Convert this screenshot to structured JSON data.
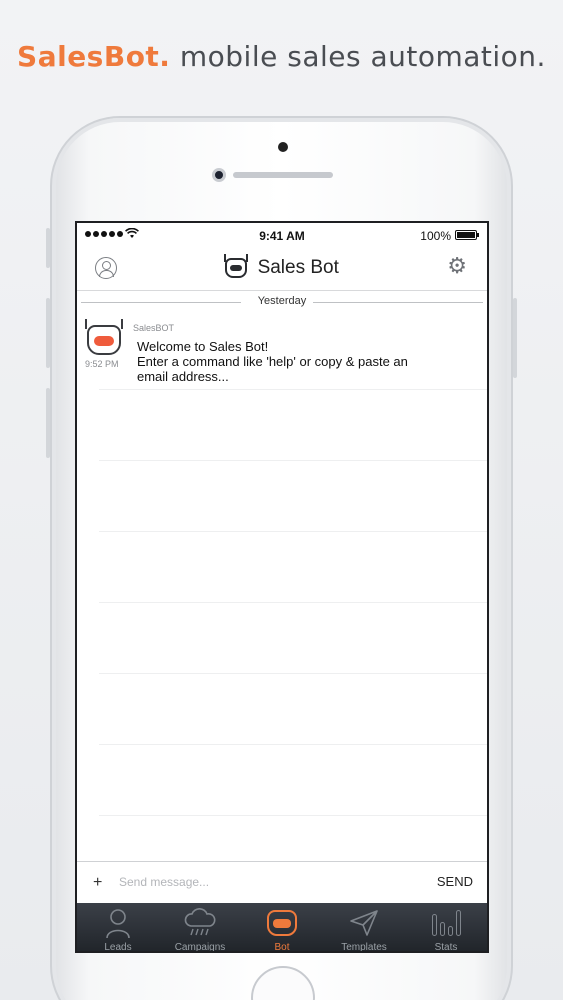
{
  "headline": {
    "brand": "SalesBot.",
    "tagline": "mobile sales automation."
  },
  "status_bar": {
    "time": "9:41 AM",
    "battery": "100%"
  },
  "nav": {
    "title": "Sales Bot"
  },
  "chat": {
    "day_divider": "Yesterday",
    "messages": [
      {
        "sender": "SalesBOT",
        "time": "9:52 PM",
        "lines": [
          "Welcome to Sales Bot!",
          "Enter a command like 'help' or copy & paste an",
          "email address..."
        ]
      }
    ]
  },
  "composer": {
    "plus": "+",
    "placeholder": "Send message...",
    "send_label": "SEND"
  },
  "tabs": [
    {
      "label": "Leads",
      "icon": "person-icon"
    },
    {
      "label": "Campaigns",
      "icon": "rain-cloud-icon"
    },
    {
      "label": "Bot",
      "icon": "bot-icon",
      "active": true
    },
    {
      "label": "Templates",
      "icon": "paper-plane-icon"
    },
    {
      "label": "Stats",
      "icon": "bar-chart-icon"
    }
  ],
  "colors": {
    "brand": "#ef7a3c",
    "tabbar": "#2a2e34"
  }
}
